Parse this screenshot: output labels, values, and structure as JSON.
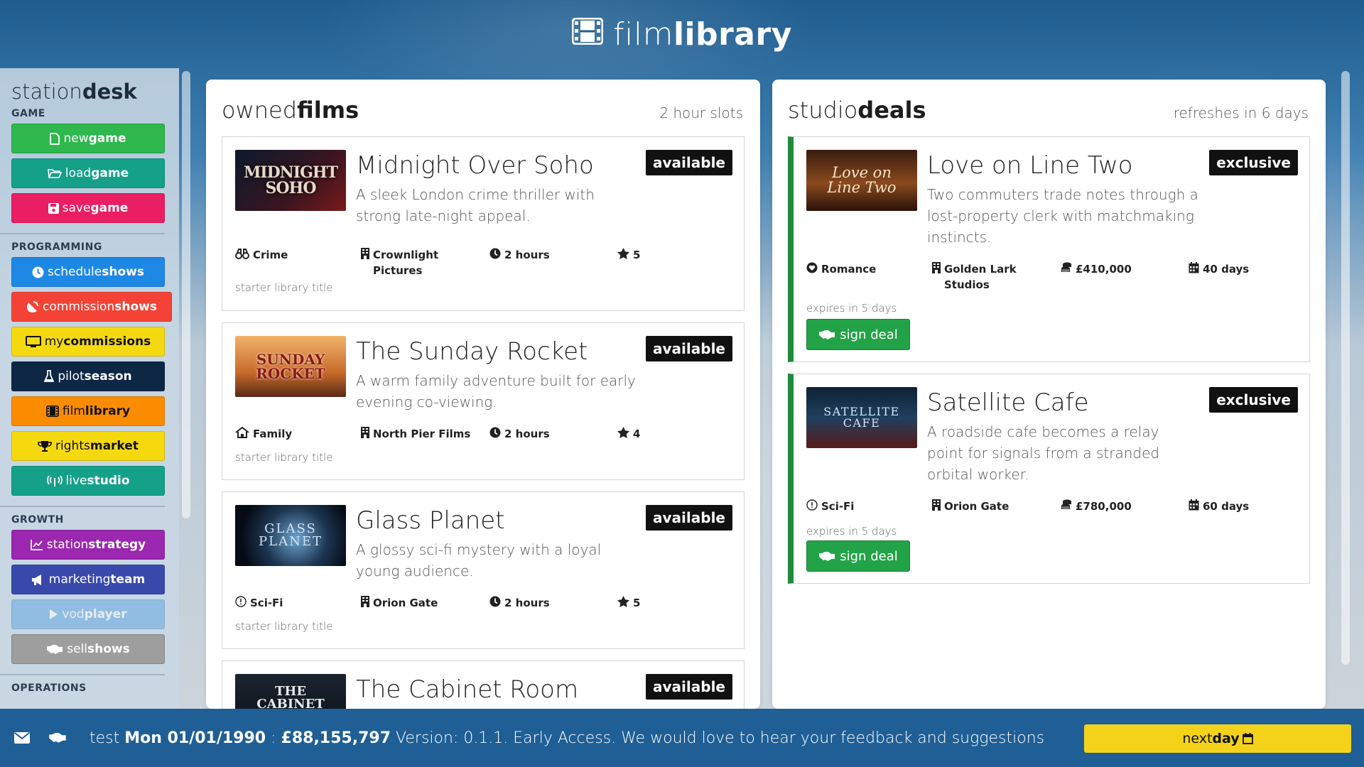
{
  "header": {
    "title_light": "film",
    "title_bold": "library",
    "icon": "film-icon"
  },
  "sidebar": {
    "title_light": "station",
    "title_bold": "desk",
    "sections": {
      "game": "GAME",
      "programming": "PROGRAMMING",
      "growth": "GROWTH",
      "operations": "OPERATIONS"
    },
    "buttons": {
      "new_game": {
        "light": "new",
        "bold": "game",
        "icon": "file-icon",
        "color": "#2eb84d"
      },
      "load_game": {
        "light": "load",
        "bold": "game",
        "icon": "folder-open-icon",
        "color": "#15a08a"
      },
      "save_game": {
        "light": "save",
        "bold": "game",
        "icon": "floppy-icon",
        "color": "#e91e63"
      },
      "schedule_shows": {
        "light": "schedule",
        "bold": "shows",
        "icon": "clock-icon",
        "color": "#1e88e5"
      },
      "commission_shows": {
        "light": "commission",
        "bold": "shows",
        "icon": "satellite-dish-icon",
        "color": "#f44336"
      },
      "my_commissions": {
        "light": "my",
        "bold": "commissions",
        "icon": "monitor-icon",
        "color": "#f5d90f"
      },
      "pilot_season": {
        "light": "pilot",
        "bold": "season",
        "icon": "flask-icon",
        "color": "#0d2745"
      },
      "film_library": {
        "light": "film",
        "bold": "library",
        "icon": "film-icon",
        "color": "#fb8c00"
      },
      "rights_market": {
        "light": "rights",
        "bold": "market",
        "icon": "trophy-icon",
        "color": "#f5d90f"
      },
      "live_studio": {
        "light": "live",
        "bold": "studio",
        "icon": "broadcast-icon",
        "color": "#15a08a"
      },
      "station_strategy": {
        "light": "station",
        "bold": "strategy",
        "icon": "chart-line-icon",
        "color": "#9c27b0"
      },
      "marketing_team": {
        "light": "marketing",
        "bold": "team",
        "icon": "megaphone-icon",
        "color": "#3949ab"
      },
      "vod_player": {
        "light": "vod",
        "bold": "player",
        "icon": "play-icon",
        "color": "#64a8e0"
      },
      "sell_shows": {
        "light": "sell",
        "bold": "shows",
        "icon": "handshake-icon",
        "color": "#9e9e9e"
      }
    }
  },
  "owned": {
    "title_light": "owned",
    "title_bold": "films",
    "meta": "2 hour slots",
    "films": [
      {
        "title": "Midnight Over Soho",
        "description": "A sleek London crime thriller with strong late-night appeal.",
        "badge": "available",
        "thumb_text": "MIDNIGHT SOHO",
        "genre": "Crime",
        "genre_icon": "binoculars-icon",
        "studio": "Crownlight Pictures",
        "duration": "2 hours",
        "rating": "5",
        "note": "starter library title"
      },
      {
        "title": "The Sunday Rocket",
        "description": "A warm family adventure built for early evening co-viewing.",
        "badge": "available",
        "thumb_text": "SUNDAY ROCKET",
        "genre": "Family",
        "genre_icon": "house-icon",
        "studio": "North Pier Films",
        "duration": "2 hours",
        "rating": "4",
        "note": "starter library title"
      },
      {
        "title": "Glass Planet",
        "description": "A glossy sci-fi mystery with a loyal young audience.",
        "badge": "available",
        "thumb_text": "GLASS PLANET",
        "genre": "Sci-Fi",
        "genre_icon": "info-circle-icon",
        "studio": "Orion Gate",
        "duration": "2 hours",
        "rating": "5",
        "note": "starter library title"
      },
      {
        "title": "The Cabinet Room",
        "badge": "available",
        "thumb_text": "THE CABINET ROOM"
      }
    ]
  },
  "deals": {
    "title_light": "studio",
    "title_bold": "deals",
    "meta": "refreshes in 6 days",
    "sign_label": "sign deal",
    "items": [
      {
        "title": "Love on Line Two",
        "description": "Two commuters trade notes through a lost-property clerk with matchmaking instincts.",
        "badge": "exclusive",
        "thumb_text": "Love on Line Two",
        "genre": "Romance",
        "genre_icon": "heart-circle-icon",
        "studio": "Golden Lark Studios",
        "price": "£410,000",
        "term": "40 days",
        "expires": "expires in 5 days"
      },
      {
        "title": "Satellite Cafe",
        "description": "A roadside cafe becomes a relay point for signals from a stranded orbital worker.",
        "badge": "exclusive",
        "thumb_text": "SATELLITE CAFE",
        "genre": "Sci-Fi",
        "genre_icon": "info-circle-icon",
        "studio": "Orion Gate",
        "price": "£780,000",
        "term": "60 days",
        "expires": "expires in 5 days"
      }
    ]
  },
  "status": {
    "player": "test",
    "date": "Mon 01/01/1990",
    "separator": ":",
    "money": "£88,155,797",
    "message": "Version: 0.1.1. Early Access. We would love to hear your feedback and suggestions",
    "next_light": "next",
    "next_bold": "day"
  }
}
